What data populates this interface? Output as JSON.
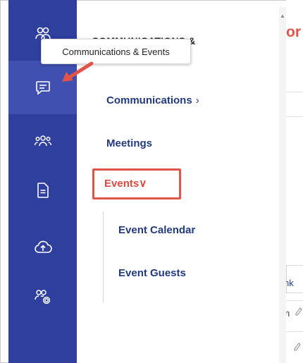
{
  "flyout": {
    "title": "COMMUNICATIONS &",
    "items": [
      {
        "label": "Communications",
        "caret": "›"
      },
      {
        "label": "Meetings"
      },
      {
        "label": "Events",
        "caret": "∨"
      },
      {
        "label": "Event Calendar"
      },
      {
        "label": "Event Guests"
      }
    ]
  },
  "tooltip": {
    "text": "Communications & Events"
  },
  "edge": {
    "title": "or",
    "link": "nk",
    "letter": "n"
  },
  "rail": {
    "icons": [
      "people-icon",
      "chat-icon",
      "group-icon",
      "document-icon",
      "cloud-upload-icon",
      "user-settings-icon"
    ]
  },
  "colors": {
    "rail": "#2f3f9e",
    "rail_active": "#3f50b0",
    "nav_text": "#233a80",
    "accent_red": "#e0544a"
  }
}
